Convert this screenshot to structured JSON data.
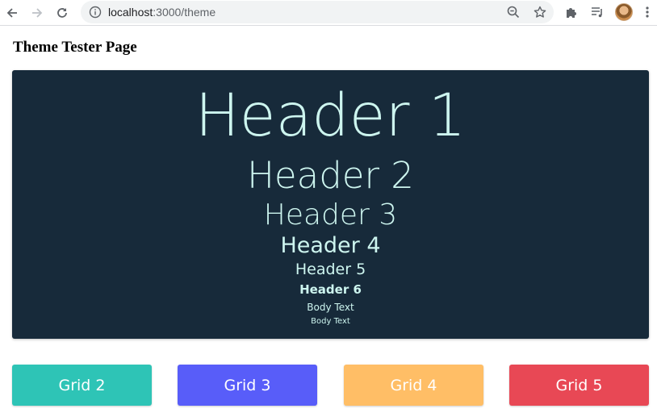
{
  "browser": {
    "url_host": "localhost",
    "url_path": ":3000/theme",
    "icons": {
      "back": "arrow-left-icon",
      "forward": "arrow-right-icon",
      "reload": "reload-icon",
      "info": "info-icon",
      "zoom": "zoom-out-icon",
      "bookmark": "star-icon",
      "extensions": "puzzle-icon",
      "reading_list": "reading-list-icon",
      "menu": "kebab-menu-icon"
    }
  },
  "page": {
    "title": "Theme Tester Page",
    "panel": {
      "background": "#172a3a",
      "text_color": "#cdf5ef",
      "h1": "Header 1",
      "h2": "Header 2",
      "h3": "Header 3",
      "h4": "Header 4",
      "h5": "Header 5",
      "h6": "Header 6",
      "body1": "Body Text",
      "body2": "Body Text"
    },
    "grid_buttons": [
      {
        "label": "Grid 2",
        "color": "#2ec4b6"
      },
      {
        "label": "Grid 3",
        "color": "#585df9"
      },
      {
        "label": "Grid 4",
        "color": "#ffbe66"
      },
      {
        "label": "Grid 5",
        "color": "#e84855"
      }
    ]
  }
}
